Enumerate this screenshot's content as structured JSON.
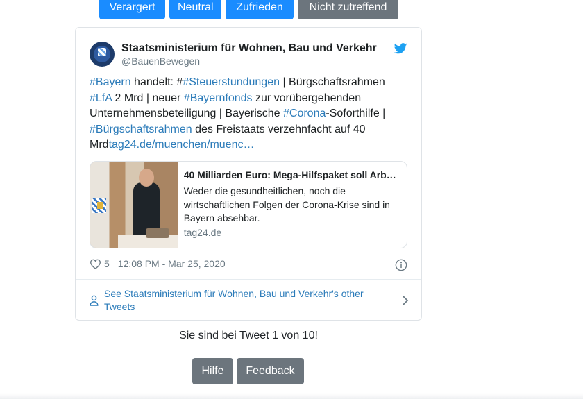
{
  "rating_buttons": {
    "veraergert": "Verärgert",
    "neutral": "Neutral",
    "zufrieden": "Zufrieden",
    "nicht_zutreffend": "Nicht zutreffend"
  },
  "tweet": {
    "author_name": "Staatsministerium für Wohnen, Bau und Verkehr",
    "author_handle": "@BauenBewegen",
    "text": {
      "t1": "#Bayern",
      "t2": " handelt: #",
      "t3": "#Steuerstundungen",
      "t4": " | Bürgschaftsrahmen ",
      "t5": "#LfA",
      "t6": " 2 Mrd | neuer ",
      "t7": "#Bayernfonds",
      "t8": " zur vorübergehenden Unternehmensbeteiligung | Bayerische ",
      "t9": "#Corona",
      "t10": "-Soforthilfe | ",
      "t11": "#Bürgschaftsrahmen",
      "t12": " des Freistaats verzehnfacht auf 40 Mrd",
      "t13": "tag24.de/muenchen/muenc…"
    },
    "card": {
      "title": "40 Milliarden Euro: Mega-Hilfspaket soll Arb…",
      "description": "Weder die gesundheitlichen, noch die wirtschaftlichen Folgen der Corona-Krise sind in Bayern absehbar.",
      "domain": "tag24.de"
    },
    "likes": "5",
    "timestamp": "12:08 PM - Mar 25, 2020",
    "other_tweets_link": "See Staatsministerium für Wohnen, Bau und Verkehr's other Tweets"
  },
  "status_text": "Sie sind bei Tweet 1 von 10!",
  "bottom_buttons": {
    "hilfe": "Hilfe",
    "feedback": "Feedback"
  },
  "colors": {
    "primary_button": "#1a8cff",
    "secondary_button": "#6c757d",
    "twitter_link": "#2b7bb9",
    "twitter_bird": "#1da1f2"
  }
}
